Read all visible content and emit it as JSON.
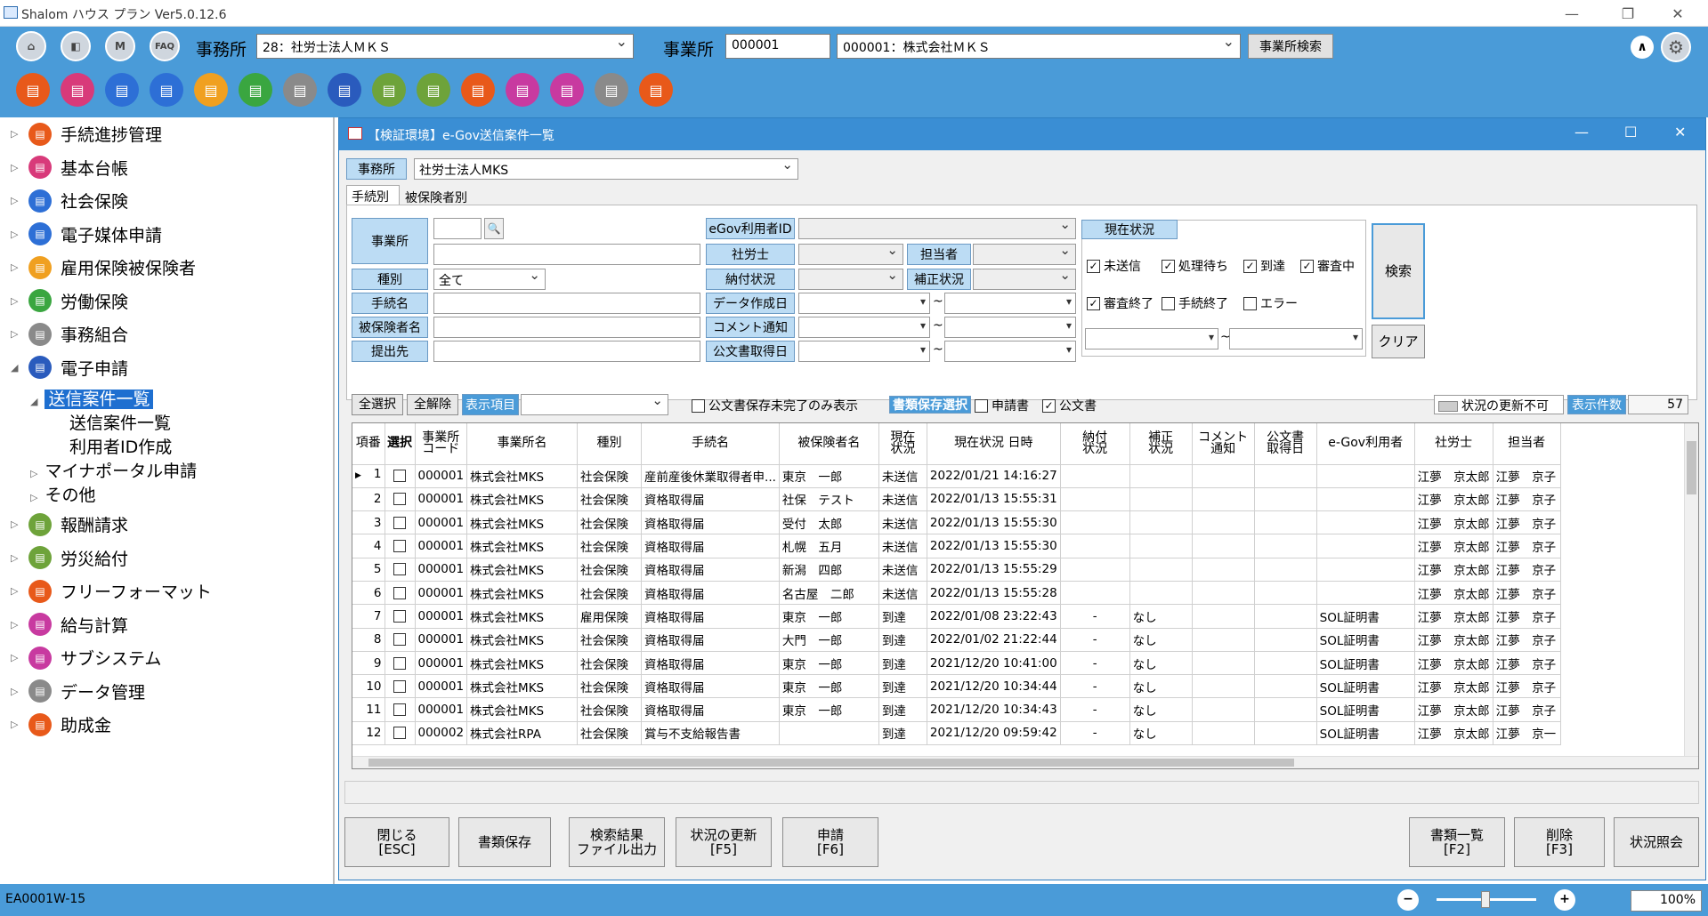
{
  "app": {
    "title": "Shalom ハウス プラン Ver5.0.12.6"
  },
  "header": {
    "icons": [
      "home-icon",
      "back-icon",
      "m-icon",
      "faq-icon"
    ],
    "icon_labels": {
      "m": "M",
      "faq": "FAQ"
    },
    "office_label": "事務所",
    "office_value": "28：社労士法人ＭＫＳ",
    "establishment_label": "事業所",
    "establishment_code": "000001",
    "establishment_value": "000001：株式会社ＭＫＳ",
    "search_button": "事業所検索",
    "toolbar_colors": [
      "#e8591a",
      "#d83a7a",
      "#2d6fd6",
      "#2d6fd6",
      "#f0a020",
      "#3aa640",
      "#8a8a8a",
      "#2a5bbd",
      "#6ea33a",
      "#6ea33a",
      "#e8591a",
      "#c83aa0",
      "#c83aa0",
      "#8a8a8a",
      "#e8591a"
    ]
  },
  "sidebar": {
    "items": [
      {
        "label": "手続進捗管理",
        "color": "#e8591a"
      },
      {
        "label": "基本台帳",
        "color": "#d83a7a"
      },
      {
        "label": "社会保険",
        "color": "#2d6fd6"
      },
      {
        "label": "電子媒体申請",
        "color": "#2d6fd6"
      },
      {
        "label": "雇用保険被保険者",
        "color": "#f0a020"
      },
      {
        "label": "労働保険",
        "color": "#3aa640"
      },
      {
        "label": "事務組合",
        "color": "#8a8a8a"
      },
      {
        "label": "電子申請",
        "color": "#2a5bbd"
      }
    ],
    "sub": {
      "selected": "送信案件一覧",
      "children": [
        "送信案件一覧",
        "利用者ID作成"
      ],
      "others": [
        "マイナポータル申請",
        "その他"
      ]
    },
    "items2": [
      {
        "label": "報酬請求",
        "color": "#6ea33a"
      },
      {
        "label": "労災給付",
        "color": "#6ea33a"
      },
      {
        "label": "フリーフォーマット",
        "color": "#e8591a"
      },
      {
        "label": "給与計算",
        "color": "#c83aa0"
      },
      {
        "label": "サブシステム",
        "color": "#c83aa0"
      },
      {
        "label": "データ管理",
        "color": "#8a8a8a"
      },
      {
        "label": "助成金",
        "color": "#e8591a"
      }
    ]
  },
  "window": {
    "title": "【検証環境】e-Gov送信案件一覧",
    "office_label": "事務所",
    "office_value": "社労士法人MKS",
    "tabs": [
      "手続別",
      "被保険者別"
    ],
    "form": {
      "jigyosho": "事業所",
      "shubetsu": "種別",
      "shubetsu_value": "全て",
      "tetsuzuki": "手続名",
      "hihokensha": "被保険者名",
      "teishutsu": "提出先",
      "egov_id": "eGov利用者ID",
      "sharoushi": "社労士",
      "tantou": "担当者",
      "nofu": "納付状況",
      "hosei": "補正状況",
      "data_date": "データ作成日",
      "comment": "コメント通知",
      "koubun": "公文書取得日",
      "tilde": "~",
      "status_label": "現在状況",
      "status_checks": [
        {
          "label": "未送信",
          "checked": true
        },
        {
          "label": "処理待ち",
          "checked": true
        },
        {
          "label": "到達",
          "checked": true
        },
        {
          "label": "審査中",
          "checked": true
        },
        {
          "label": "審査終了",
          "checked": true
        },
        {
          "label": "手続終了",
          "checked": false
        },
        {
          "label": "エラー",
          "checked": false
        }
      ],
      "search_button": "検索",
      "clear_button": "クリア"
    },
    "grid_toolbar": {
      "select_all": "全選択",
      "deselect_all": "全解除",
      "display_items": "表示項目",
      "only_incomplete": "公文書保存未完了のみ表示",
      "doc_save_select": "書類保存選択",
      "shinseisho": "申請書",
      "koubunsho": "公文書",
      "status_no_update": "状況の更新不可",
      "count_label": "表示件数",
      "count_value": "57"
    },
    "columns": [
      "項番",
      "選択",
      "事業所\nコード",
      "事業所名",
      "種別",
      "手続名",
      "被保険者名",
      "現在\n状況",
      "現在状況 日時",
      "納付\n状況",
      "補正\n状況",
      "コメント\n通知",
      "公文書\n取得日",
      "e-Gov利用者",
      "社労士",
      "担当者"
    ],
    "rows": [
      [
        "1",
        "000001",
        "株式会社MKS",
        "社会保険",
        "産前産後休業取得者申...",
        "東京　一郎",
        "未送信",
        "2022/01/21 14:16:27",
        "",
        "",
        "",
        "",
        "",
        "江夢　京太郎",
        "江夢　京子"
      ],
      [
        "2",
        "000001",
        "株式会社MKS",
        "社会保険",
        "資格取得届",
        "社保　テスト",
        "未送信",
        "2022/01/13 15:55:31",
        "",
        "",
        "",
        "",
        "",
        "江夢　京太郎",
        "江夢　京子"
      ],
      [
        "3",
        "000001",
        "株式会社MKS",
        "社会保険",
        "資格取得届",
        "受付　太郎",
        "未送信",
        "2022/01/13 15:55:30",
        "",
        "",
        "",
        "",
        "",
        "江夢　京太郎",
        "江夢　京子"
      ],
      [
        "4",
        "000001",
        "株式会社MKS",
        "社会保険",
        "資格取得届",
        "札幌　五月",
        "未送信",
        "2022/01/13 15:55:30",
        "",
        "",
        "",
        "",
        "",
        "江夢　京太郎",
        "江夢　京子"
      ],
      [
        "5",
        "000001",
        "株式会社MKS",
        "社会保険",
        "資格取得届",
        "新潟　四郎",
        "未送信",
        "2022/01/13 15:55:29",
        "",
        "",
        "",
        "",
        "",
        "江夢　京太郎",
        "江夢　京子"
      ],
      [
        "6",
        "000001",
        "株式会社MKS",
        "社会保険",
        "資格取得届",
        "名古屋　二郎",
        "未送信",
        "2022/01/13 15:55:28",
        "",
        "",
        "",
        "",
        "",
        "江夢　京太郎",
        "江夢　京子"
      ],
      [
        "7",
        "000001",
        "株式会社MKS",
        "雇用保険",
        "資格取得届",
        "東京　一郎",
        "到達",
        "2022/01/08 23:22:43",
        "-",
        "なし",
        "",
        "",
        "SOL証明書",
        "江夢　京太郎",
        "江夢　京子"
      ],
      [
        "8",
        "000001",
        "株式会社MKS",
        "社会保険",
        "資格取得届",
        "大門　一郎",
        "到達",
        "2022/01/02 21:22:44",
        "-",
        "なし",
        "",
        "",
        "SOL証明書",
        "江夢　京太郎",
        "江夢　京子"
      ],
      [
        "9",
        "000001",
        "株式会社MKS",
        "社会保険",
        "資格取得届",
        "東京　一郎",
        "到達",
        "2021/12/20 10:41:00",
        "-",
        "なし",
        "",
        "",
        "SOL証明書",
        "江夢　京太郎",
        "江夢　京子"
      ],
      [
        "10",
        "000001",
        "株式会社MKS",
        "社会保険",
        "資格取得届",
        "東京　一郎",
        "到達",
        "2021/12/20 10:34:44",
        "-",
        "なし",
        "",
        "",
        "SOL証明書",
        "江夢　京太郎",
        "江夢　京子"
      ],
      [
        "11",
        "000001",
        "株式会社MKS",
        "社会保険",
        "資格取得届",
        "東京　一郎",
        "到達",
        "2021/12/20 10:34:43",
        "-",
        "なし",
        "",
        "",
        "SOL証明書",
        "江夢　京太郎",
        "江夢　京子"
      ],
      [
        "12",
        "000002",
        "株式会社RPA",
        "社会保険",
        "賞与不支給報告書",
        "",
        "到達",
        "2021/12/20 09:59:42",
        "-",
        "なし",
        "",
        "",
        "SOL証明書",
        "江夢　京太郎",
        "江夢　京一"
      ]
    ],
    "buttons": {
      "close": "閉じる\n[ESC]",
      "save_docs": "書類保存",
      "export": "検索結果\nファイル出力",
      "update_status": "状況の更新\n[F5]",
      "apply": "申請\n[F6]",
      "doc_list": "書類一覧\n[F2]",
      "delete": "削除\n[F3]",
      "inquiry": "状況照会"
    }
  },
  "statusbar": {
    "code": "EA0001W-15",
    "zoom": "100%"
  }
}
